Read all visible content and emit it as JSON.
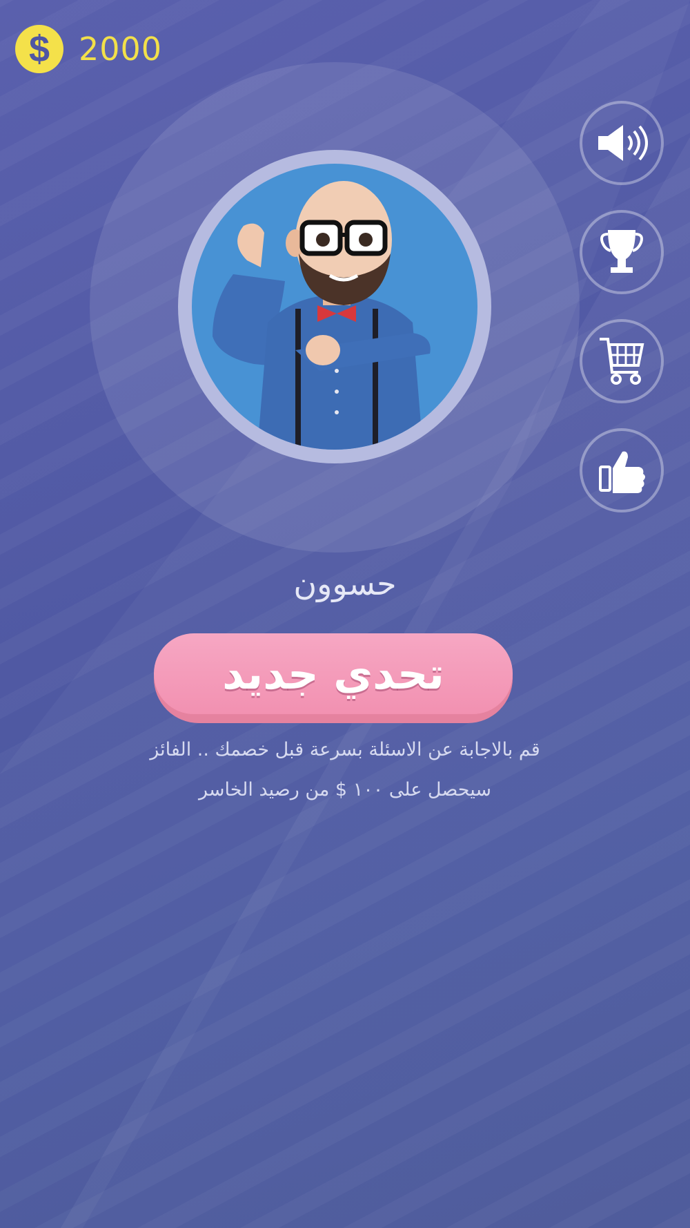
{
  "coins": {
    "icon": "dollar-coin-icon",
    "amount": "2000"
  },
  "player": {
    "name": "حسوون"
  },
  "challenge": {
    "label": "تحدي جديد"
  },
  "description": {
    "line1": "قم بالاجابة عن الاسئلة بسرعة قبل خصمك .. الفائز",
    "line2": "سيحصل على ١٠٠ $ من رصيد الخاسر"
  },
  "side_buttons": [
    {
      "icon": "speaker-icon"
    },
    {
      "icon": "trophy-icon"
    },
    {
      "icon": "cart-icon"
    },
    {
      "icon": "thumbs-up-icon"
    }
  ],
  "colors": {
    "accent_yellow": "#f2e04a",
    "button_pink": "#f291b1",
    "avatar_bg": "#4892d4"
  }
}
